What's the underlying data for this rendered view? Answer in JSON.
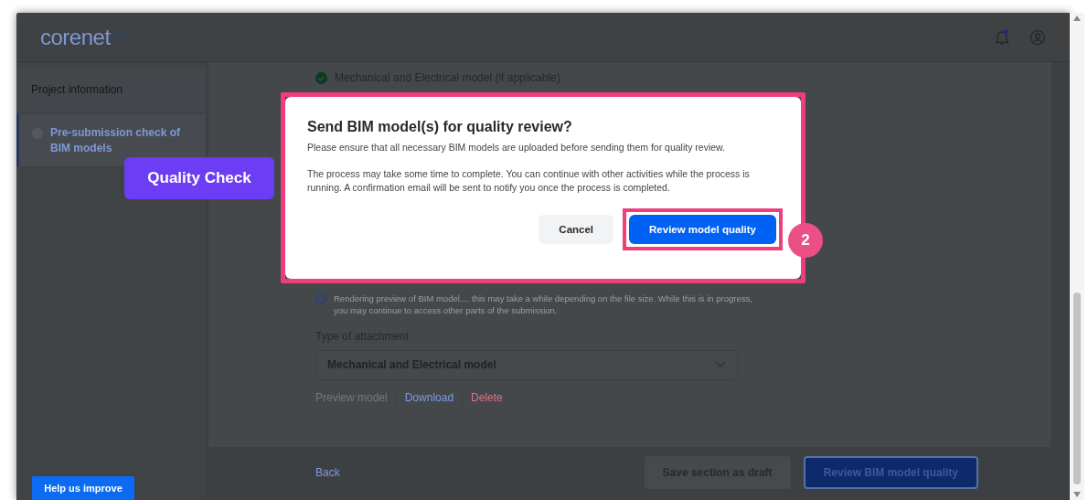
{
  "header": {
    "logo": "corenet",
    "notification": true
  },
  "sidebar": {
    "items": [
      {
        "label": "Project information",
        "selected": false
      },
      {
        "label": "Pre-submission check of BIM models",
        "selected": true
      }
    ]
  },
  "content": {
    "checklist": [
      {
        "label": "Mechanical and Electrical model (if applicable)",
        "checked": true
      }
    ],
    "status": "Rendering preview of BIM model.... this may take a while depending on the file size. While this is in progress, you may continue to access other parts of the submission.",
    "field": {
      "label": "Type of attachment",
      "value": "Mechanical and Electrical model"
    },
    "links": [
      {
        "label": "Preview model",
        "kind": "disabled"
      },
      {
        "label": "Download",
        "kind": "link"
      },
      {
        "label": "Delete",
        "kind": "danger"
      }
    ]
  },
  "footer": {
    "back": "Back",
    "buttons": [
      {
        "label": "Save section as draft",
        "kind": "secondary"
      },
      {
        "label": "Review BIM model quality",
        "kind": "primary"
      }
    ]
  },
  "help_button": "Help us improve",
  "dialog": {
    "title": "Send BIM model(s) for quality review?",
    "paragraphs": [
      "Please ensure that all necessary BIM models are uploaded before sending them for quality review.",
      "The process may take some time to complete. You can continue with other activities while the process is running. A confirmation email will be sent to notify you once the process is completed."
    ],
    "buttons": [
      {
        "label": "Cancel",
        "kind": "secondary",
        "highlighted": false
      },
      {
        "label": "Review model quality",
        "kind": "primary",
        "highlighted": true
      }
    ]
  },
  "annotations": {
    "callout": "Quality Check",
    "step": "2"
  }
}
